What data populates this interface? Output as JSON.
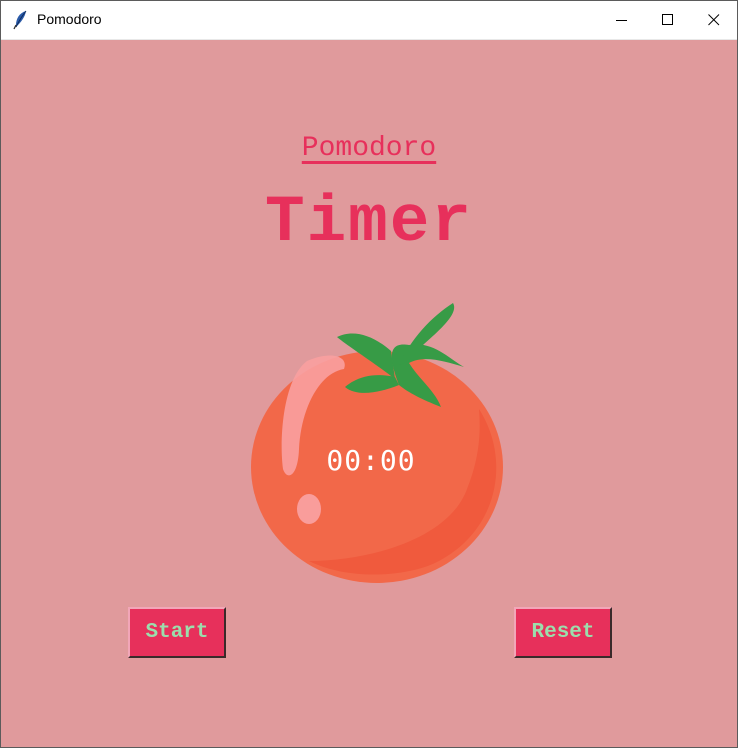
{
  "window": {
    "title": "Pomodoro",
    "icon": "feather-icon",
    "controls": [
      "minimize-icon",
      "maximize-icon",
      "close-icon"
    ]
  },
  "header": {
    "subtitle": "Pomodoro",
    "title": "Timer"
  },
  "timer": {
    "display": "00:00",
    "image": "tomato-icon"
  },
  "buttons": {
    "start": "Start",
    "reset": "Reset"
  },
  "colors": {
    "background": "#e09a9c",
    "accent": "#e7305b",
    "button_text": "#9bdeac",
    "tomato": "#f26849",
    "leaf": "#379b46"
  }
}
